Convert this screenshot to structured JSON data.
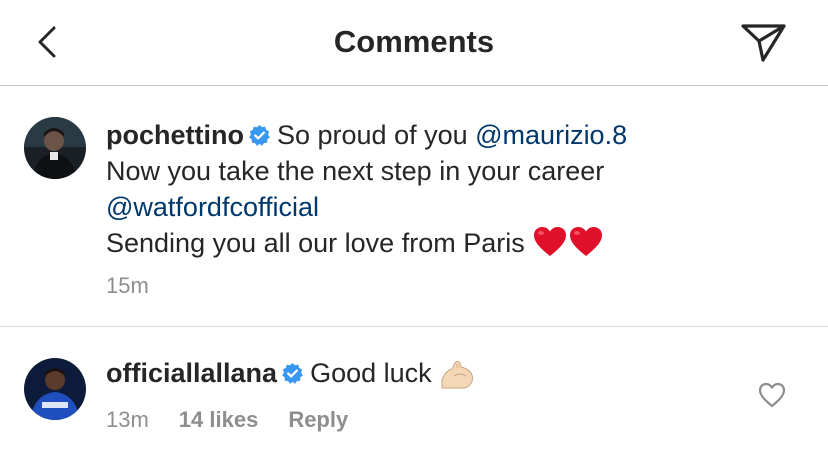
{
  "header": {
    "back_icon": "chevron-left-icon",
    "title": "Comments",
    "share_icon": "paper-plane-icon"
  },
  "caption": {
    "username": "pochettino",
    "verified_icon": "verified-badge-icon",
    "text_1": "So proud of you",
    "mention_1": "@maurizio.8",
    "text_2": "Now you take the next step in your career",
    "mention_2": "@watfordfcofficial",
    "text_3": "Sending you all our love from Paris",
    "emoji": "red-heart-icon x2",
    "time": "15m"
  },
  "comments": [
    {
      "username": "officiallallana",
      "verified_icon": "verified-badge-icon",
      "text": "Good luck",
      "emoji": "flexed-biceps-icon",
      "time": "13m",
      "likes": "14 likes",
      "reply_label": "Reply",
      "like_icon": "heart-outline-icon"
    }
  ],
  "colors": {
    "text": "#262626",
    "mention": "#00376b",
    "secondary": "#8e8e8e",
    "verified": "#3897f0",
    "heart_emoji": "#e0102a",
    "divider": "#dbdbdb"
  }
}
